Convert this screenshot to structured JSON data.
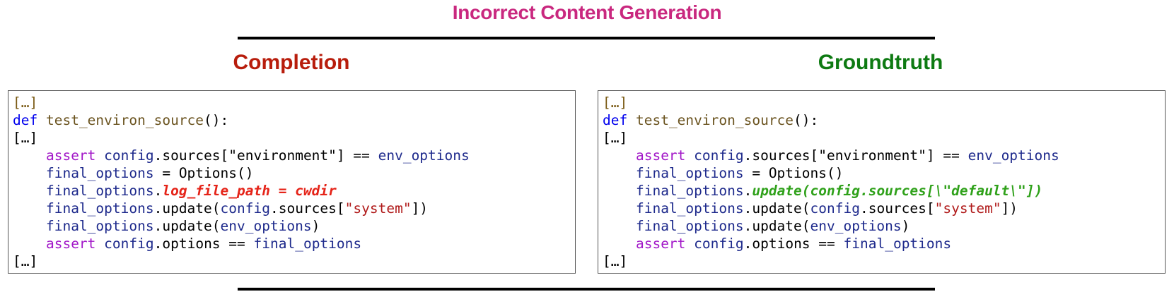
{
  "title": "Incorrect Content Generation",
  "colors": {
    "title": "#c9287f",
    "completion": "#b81d0c",
    "groundtruth": "#0e7a12",
    "wrong_highlight": "#e52318",
    "right_highlight": "#2fa11a"
  },
  "completion": {
    "heading": "Completion",
    "lines": {
      "ellipsis_top": "[…]",
      "def_kw": "def",
      "def_name": "test_environ_source",
      "def_rest": "():",
      "ellipsis_mid": "[…]",
      "l1_assert": "assert",
      "l1_config": "config",
      "l1_rest": ".sources[\"environment\"] == ",
      "l1_env": "env_options",
      "l2_var": "final_options",
      "l2_rest": " = Options()",
      "l3_var": "final_options",
      "l3_dot": ".",
      "l3_highlight": "log_file_path = cwdir",
      "l4_var": "final_options",
      "l4_mid": ".update(",
      "l4_config": "config",
      "l4_mid2": ".sources[",
      "l4_str": "\"system\"",
      "l4_end": "])",
      "l5_var": "final_options",
      "l5_mid": ".update(",
      "l5_env": "env_options",
      "l5_end": ")",
      "l6_assert": "assert",
      "l6_config": "config",
      "l6_mid": ".options == ",
      "l6_final": "final_options",
      "ellipsis_bottom": "[…]"
    }
  },
  "groundtruth": {
    "heading": "Groundtruth",
    "lines": {
      "ellipsis_top": "[…]",
      "def_kw": "def",
      "def_name": "test_environ_source",
      "def_rest": "():",
      "ellipsis_mid": "[…]",
      "l1_assert": "assert",
      "l1_config": "config",
      "l1_rest": ".sources[\"environment\"] == ",
      "l1_env": "env_options",
      "l2_var": "final_options",
      "l2_rest": " = Options()",
      "l3_var": "final_options",
      "l3_dot": ".",
      "l3_highlight": "update(config.sources[\\\"default\\\"])",
      "l4_var": "final_options",
      "l4_mid": ".update(",
      "l4_config": "config",
      "l4_mid2": ".sources[",
      "l4_str": "\"system\"",
      "l4_end": "])",
      "l5_var": "final_options",
      "l5_mid": ".update(",
      "l5_env": "env_options",
      "l5_end": ")",
      "l6_assert": "assert",
      "l6_config": "config",
      "l6_mid": ".options == ",
      "l6_final": "final_options",
      "ellipsis_bottom": "[…]"
    }
  }
}
